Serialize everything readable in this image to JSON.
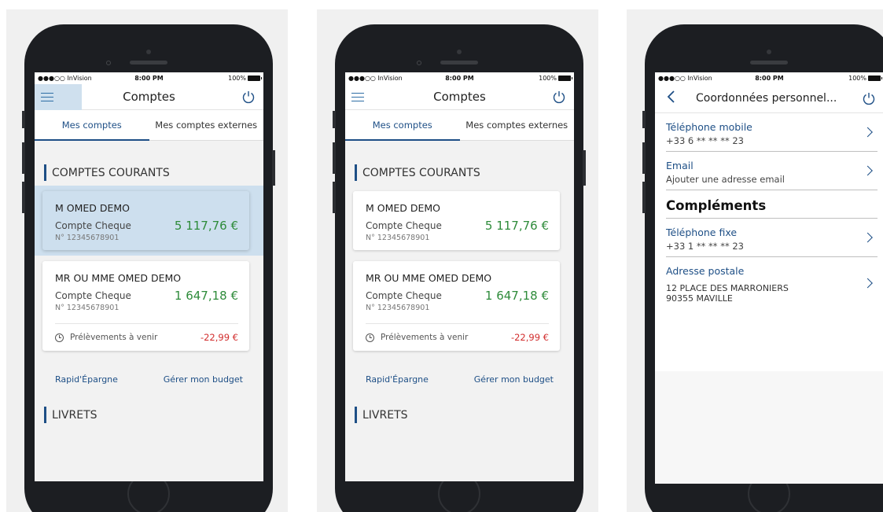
{
  "status_bar": {
    "carrier": "●●●○○ InVision",
    "time": "8:00 PM",
    "battery": "100%"
  },
  "accounts_screen": {
    "title": "Comptes",
    "tabs": [
      "Mes comptes",
      "Mes comptes externes"
    ],
    "section_current": "COMPTES COURANTS",
    "accounts": [
      {
        "holder": "M OMED DEMO",
        "type": "Compte Cheque",
        "number": "N° 12345678901",
        "balance": "5 117,76 €"
      },
      {
        "holder": "MR OU MME OMED DEMO",
        "type": "Compte Cheque",
        "number": "N° 12345678901",
        "balance": "1 647,18 €",
        "pending_label": "Prélèvements à venir",
        "pending_amount": "-22,99 €"
      }
    ],
    "link_savings": "Rapid'Épargne",
    "link_budget": "Gérer mon budget",
    "section_savings": "LIVRETS"
  },
  "contact_screen": {
    "title": "Coordonnées personnel...",
    "mobile_label": "Téléphone mobile",
    "mobile_value": "+33 6 ** ** ** 23",
    "email_label": "Email",
    "email_value": "Ajouter une adresse email",
    "complements_heading": "Compléments",
    "landline_label": "Téléphone fixe",
    "landline_value": "+33 1 ** ** ** 23",
    "address_label": "Adresse postale",
    "address_line1": "12 PLACE DES MARRONIERS",
    "address_line2": "90355 MAVILLE"
  },
  "colors": {
    "accent": "#1e4f86",
    "positive": "#2e8b3a",
    "negative": "#d22d2d",
    "highlight": "#cddfee"
  }
}
